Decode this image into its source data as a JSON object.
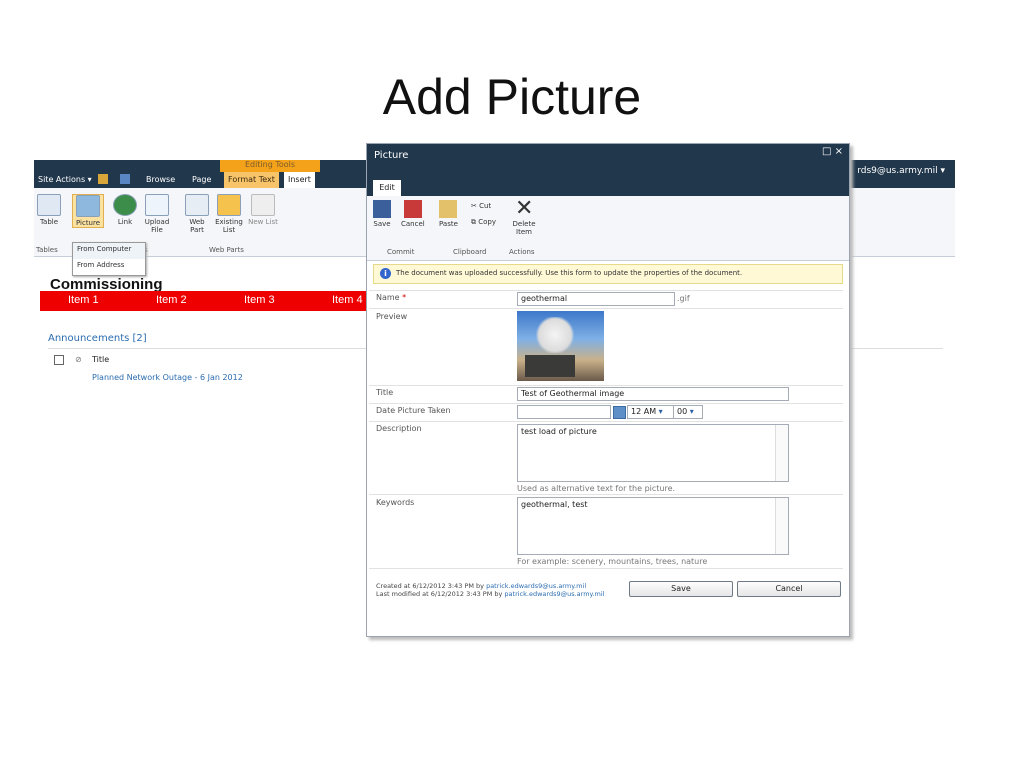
{
  "slide": {
    "title": "Add Picture"
  },
  "sharepoint": {
    "contextual_group": "Editing Tools",
    "top_tabs": [
      "Site Actions ▾",
      "Browse",
      "Page",
      "Format Text",
      "Insert"
    ],
    "user": "rds9@us.army.mil ▾",
    "ribbon_buttons": [
      "Table",
      "Picture",
      "Link",
      "Upload File",
      "Web Part",
      "Existing List",
      "New List"
    ],
    "ribbon_groups": [
      "Tables",
      "s",
      "Web Parts"
    ],
    "picture_menu": [
      "From Computer",
      "From Address"
    ],
    "site_title": "Commissioning",
    "nav_items": [
      "Item 1",
      "Item 2",
      "Item 3",
      "Item 4"
    ],
    "announcements_title": "Announcements [2]",
    "column_title": "Title",
    "announcement_item": "Planned Network Outage - 6 Jan 2012",
    "colors": {
      "topbar": "#21374c",
      "nav": "#ee0000",
      "accent": "#f5a21b"
    }
  },
  "dialog": {
    "title": "Picture",
    "controls": "□ ×",
    "tab": "Edit",
    "ribbon": {
      "save": "Save",
      "cancel": "Cancel",
      "paste": "Paste",
      "cut": "Cut",
      "copy": "Copy",
      "delete": "Delete Item",
      "groups": [
        "Commit",
        "Clipboard",
        "Actions"
      ]
    },
    "message": "The document was uploaded successfully. Use this form to update the properties of the document.",
    "fields": {
      "name_label": "Name",
      "required_mark": "*",
      "name_value": "geothermal",
      "name_ext": ".gif",
      "preview_label": "Preview",
      "title_label": "Title",
      "title_value": "Test of Geothermal image",
      "date_label": "Date Picture Taken",
      "hour": "12 AM",
      "minute": "00",
      "description_label": "Description",
      "description_value": "test load of picture",
      "description_hint": "Used as alternative text for the picture.",
      "keywords_label": "Keywords",
      "keywords_value": "geothermal, test",
      "keywords_hint": "For example: scenery, mountains, trees, nature"
    },
    "audit": {
      "created_prefix": "Created at 6/12/2012 3:43 PM by ",
      "created_by": "patrick.edwards9@us.army.mil",
      "modified_prefix": "Last modified at 6/12/2012 3:43 PM by ",
      "modified_by": "patrick.edwards9@us.army.mil"
    },
    "buttons": {
      "save": "Save",
      "cancel": "Cancel"
    }
  }
}
